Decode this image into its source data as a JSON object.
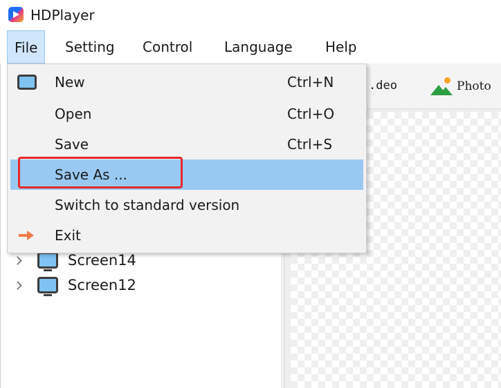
{
  "app": {
    "title": "HDPlayer",
    "icon": "hdplayer-logo-icon"
  },
  "menubar": {
    "items": [
      {
        "label": "File"
      },
      {
        "label": "Setting"
      },
      {
        "label": "Control"
      },
      {
        "label": "Language"
      },
      {
        "label": "Help"
      }
    ]
  },
  "toolbar": {
    "video_label": ".deo",
    "photo_label": "Photo",
    "photo_icon": "landscape-photo-icon"
  },
  "tree": {
    "items": [
      {
        "label": "Screen14",
        "icon": "monitor-icon"
      },
      {
        "label": "Screen12",
        "icon": "monitor-icon"
      }
    ]
  },
  "file_menu": {
    "items": [
      {
        "label": "New",
        "shortcut": "Ctrl+N",
        "icon": "monitor-icon"
      },
      {
        "label": "Open",
        "shortcut": "Ctrl+O"
      },
      {
        "label": "Save",
        "shortcut": "Ctrl+S"
      },
      {
        "label": "Save As ...",
        "shortcut": "",
        "state": "hovered"
      },
      {
        "label": "Switch to standard version",
        "shortcut": ""
      },
      {
        "label": "Exit",
        "shortcut": "",
        "icon": "exit-arrow-icon"
      }
    ]
  },
  "colors": {
    "menu_hover": "#99c9f1",
    "open_menu_bg": "#cfe6fb",
    "highlight_border": "#e8262b",
    "exit_icon": "#f07a4a"
  }
}
